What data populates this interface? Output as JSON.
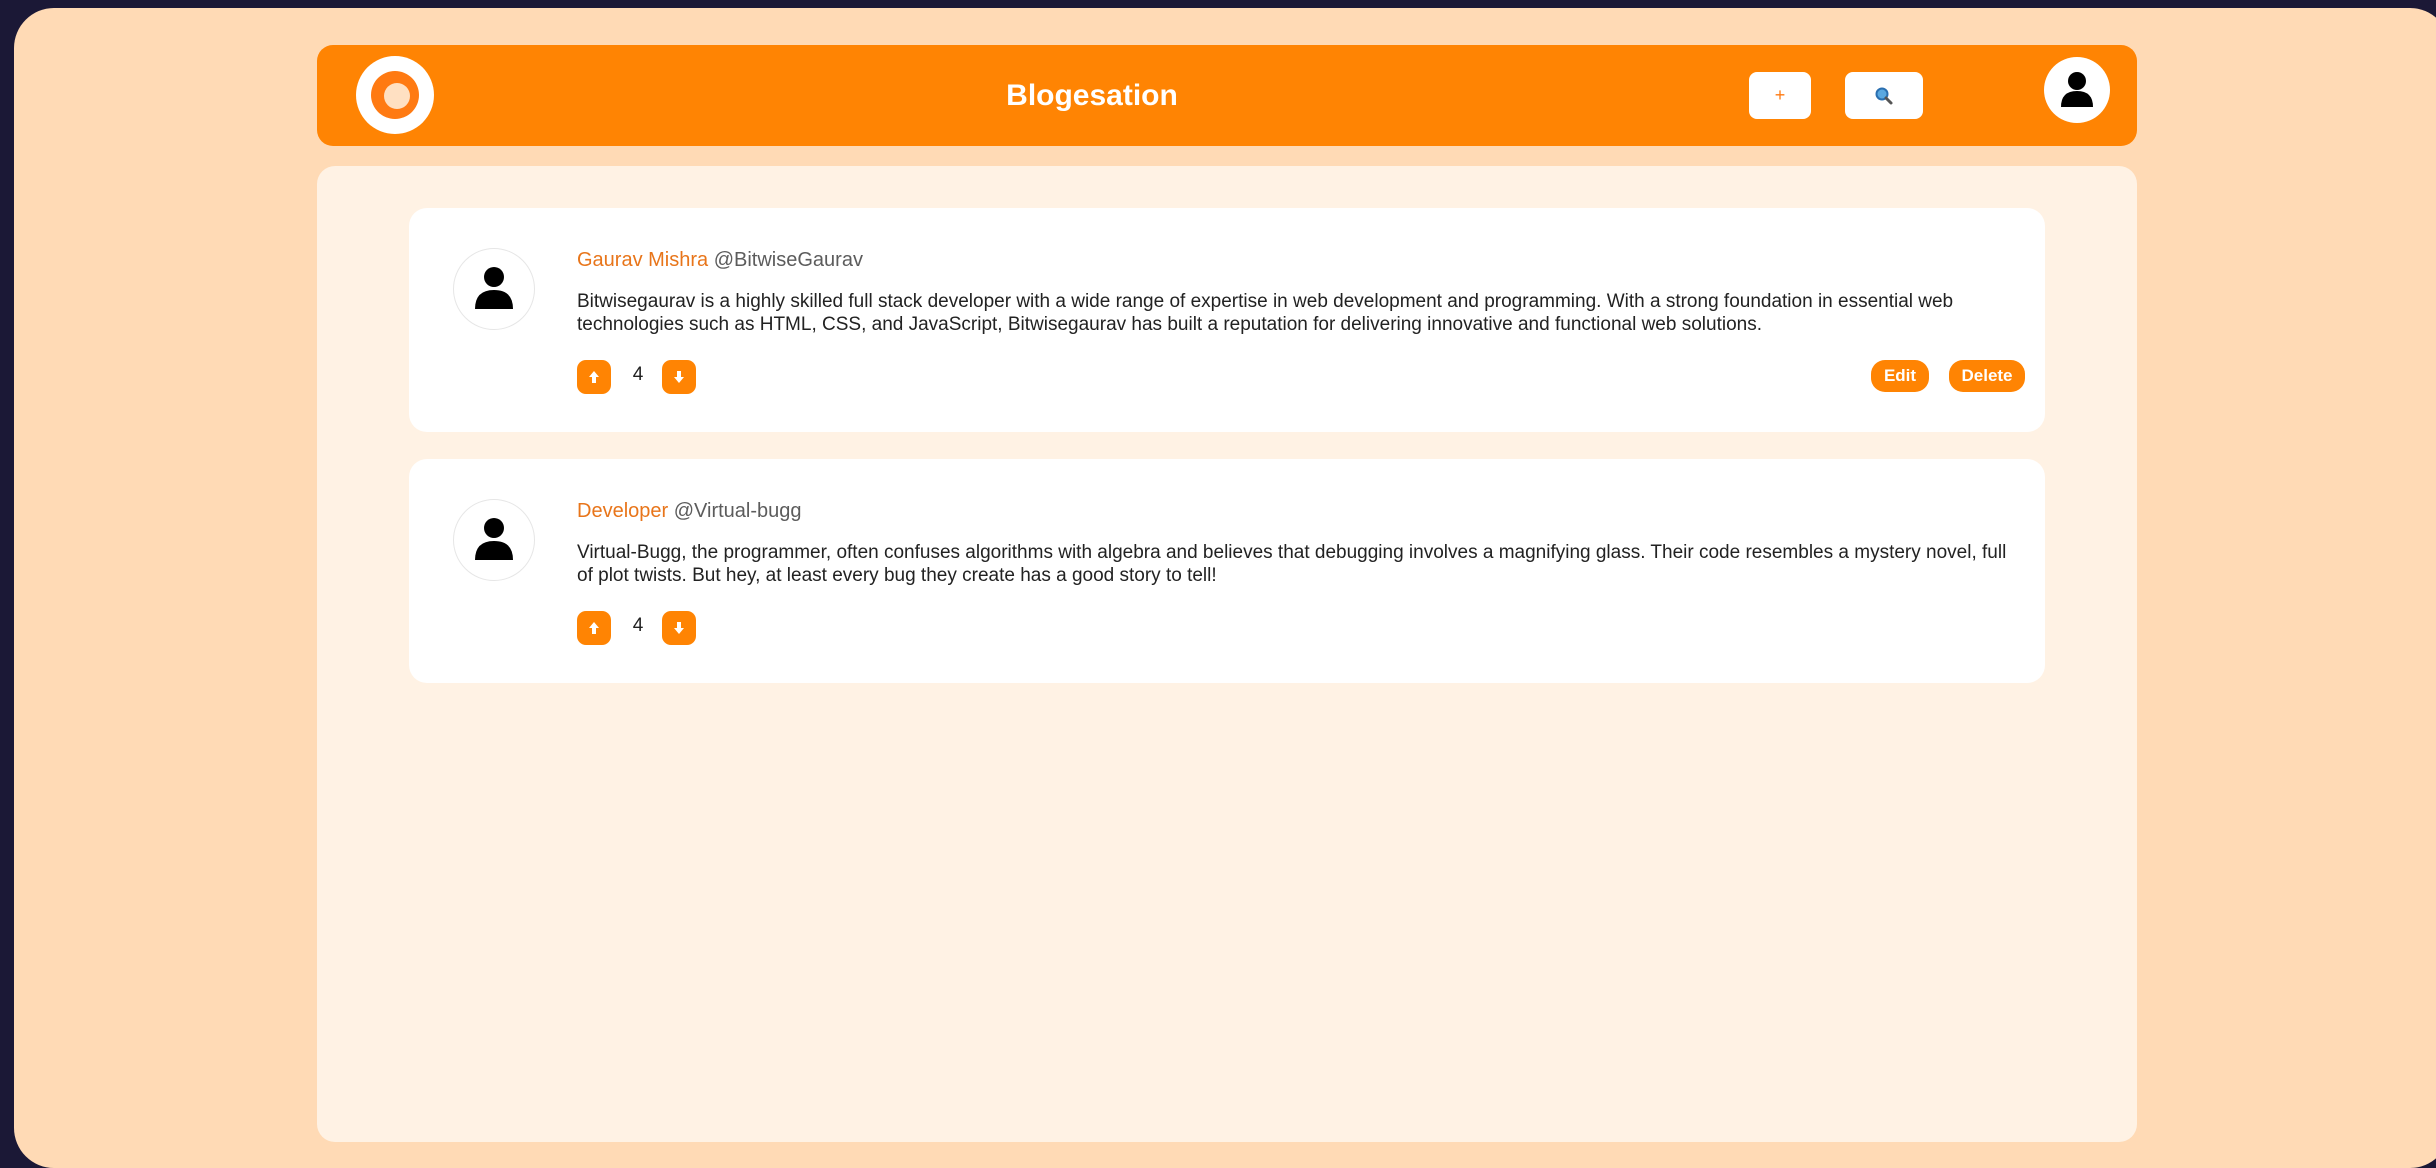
{
  "header": {
    "title": "Blogesation",
    "add_label": "+",
    "search_icon": "search-icon",
    "logo_icon": "ring-logo",
    "avatar_icon": "user-icon"
  },
  "posts": [
    {
      "author_name": "Gaurav Mishra",
      "author_handle": "@BitwiseGaurav",
      "body": "Bitwisegaurav is a highly skilled full stack developer with a wide range of expertise in web development and programming. With a strong foundation in essential web technologies such as HTML, CSS, and JavaScript, Bitwisegaurav has built a reputation for delivering innovative and functional web solutions.",
      "votes": "4",
      "edit_label": "Edit",
      "delete_label": "Delete"
    },
    {
      "author_name": "Developer",
      "author_handle": "@Virtual-bugg",
      "body": "Virtual-Bugg, the programmer, often confuses algorithms with algebra and believes that debugging involves a magnifying glass. Their code resembles a mystery novel, full of plot twists. But hey, at least every bug they create has a good story to tell!",
      "votes": "4"
    }
  ],
  "colors": {
    "accent": "#ff8403",
    "page_background": "#ffdab5",
    "content_background": "#fff2e4",
    "author_name": "#e8751a"
  }
}
